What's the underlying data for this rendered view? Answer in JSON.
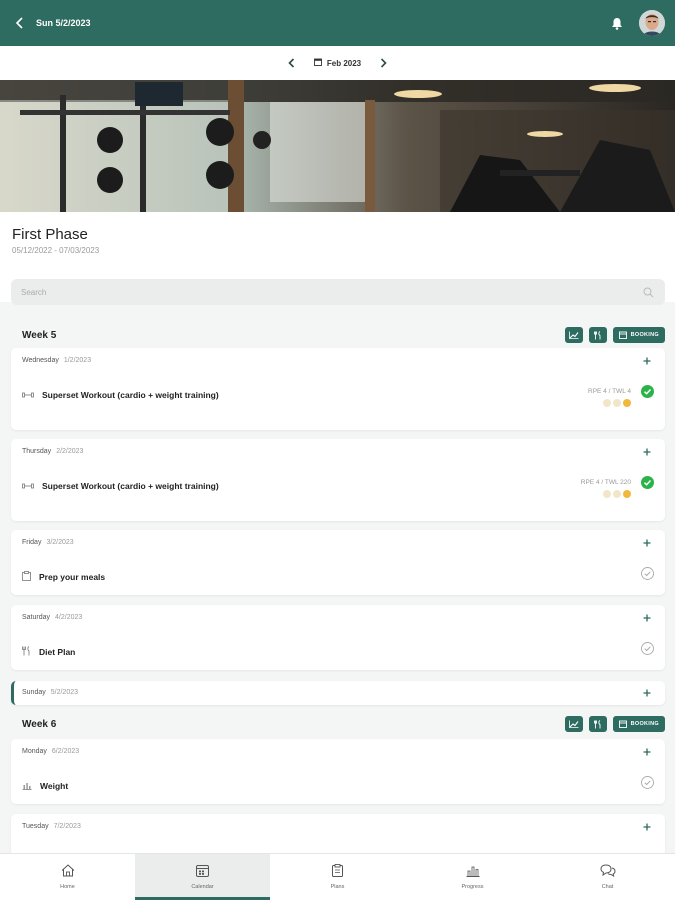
{
  "header": {
    "title": "Sun 5/2/2023"
  },
  "month_nav": {
    "label": "Feb 2023"
  },
  "phase": {
    "title": "First Phase",
    "dates": "05/12/2022 - 07/03/2023"
  },
  "search": {
    "placeholder": "Search"
  },
  "weeks": [
    {
      "title": "Week 5",
      "booking_label": "BOOKING"
    },
    {
      "title": "Week 6",
      "booking_label": "BOOKING"
    }
  ],
  "days": [
    {
      "day": "Wednesday",
      "date": "1/2/2023",
      "item": "Superset Workout (cardio + weight training)",
      "stat": "RPE 4 / TWL 4"
    },
    {
      "day": "Thursday",
      "date": "2/2/2023",
      "item": "Superset Workout (cardio + weight training)",
      "stat": "RPE 4 / TWL 220"
    },
    {
      "day": "Friday",
      "date": "3/2/2023",
      "item": "Prep your meals"
    },
    {
      "day": "Saturday",
      "date": "4/2/2023",
      "item": "Diet Plan"
    },
    {
      "day": "Sunday",
      "date": "5/2/2023"
    },
    {
      "day": "Monday",
      "date": "6/2/2023",
      "item": "Weight"
    },
    {
      "day": "Tuesday",
      "date": "7/2/2023"
    }
  ],
  "nav": {
    "home": "Home",
    "calendar": "Calendar",
    "plans": "Plans",
    "progress": "Progress",
    "chat": "Chat"
  },
  "colors": {
    "accent": "#2e6b61",
    "complete": "#2bb34a"
  }
}
